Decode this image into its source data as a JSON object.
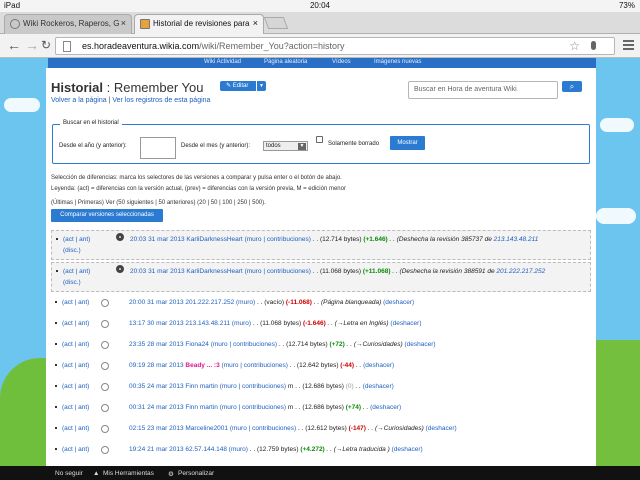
{
  "status": {
    "carrier": "iPad",
    "time": "20:04",
    "battery": "73%"
  },
  "tabs": [
    {
      "title": "Wiki Rockeros, Raperos, G",
      "close": "×"
    },
    {
      "title": "Historial de revisiones para",
      "close": "×"
    }
  ],
  "address": {
    "host": "es.horadeaventura.wikia.com",
    "path": "/wiki/Remember_You?action=history"
  },
  "nav": [
    "Wiki Actividad",
    "Página aleatoria",
    "Vídeos",
    "Imágenes nuevas"
  ],
  "page": {
    "title": "Historial",
    "subtitle": ": Remember You",
    "edit_label": "Editar",
    "back_link": "Volver a la página",
    "registry_link": "Ver los registros de esta página",
    "search_placeholder": "Buscar en Hora de aventura Wiki"
  },
  "filter": {
    "legend": "Buscar en el historial",
    "year_label": "Desde el año (y anterior):",
    "month_label": "Desde el mes (y anterior):",
    "month_value": "todos",
    "deleted_label": "Solamente borrado",
    "show_button": "Mostrar"
  },
  "help": {
    "line1": "Selección de diferencias: marca los selectores de las versiones a comparar y pulsa enter o el botón de abajo.",
    "line2": "Leyenda: (act) = diferencias con la versión actual, (prev) = diferencias con la versión previa, M = edición menor",
    "paging": "(Últimas | Primeras) Ver (50 siguientes | 50 anteriores) (20 | 50 | 100 | 250 | 500)."
  },
  "compare_button": "Comparar versiones seleccionadas",
  "revisions": [
    {
      "aa": "(act | ant)",
      "date": "20:03 31 mar 2013",
      "user": "KarliDarknessHeart",
      "tools": "(muro | contribuciones)",
      "size": ". . (12.714 bytes)",
      "diff": "(+1.646)",
      "diff_class": "pos",
      "summary": ". . (Deshecha la revisión 385737 de",
      "ip": "213.143.48.211",
      "extra": "(disc.)",
      "highlight": true,
      "radio": "on"
    },
    {
      "aa": "(act | ant)",
      "date": "20:03 31 mar 2013",
      "user": "KarliDarknessHeart",
      "tools": "(muro | contribuciones)",
      "size": ". . (11.068 bytes)",
      "diff": "(+11.068)",
      "diff_class": "pos",
      "summary": ". . (Deshecha la revisión 388591 de",
      "ip": "201.222.217.252",
      "extra": "(disc.)",
      "highlight": true,
      "radio": "on"
    },
    {
      "aa": "(act | ant)",
      "date": "20:00 31 mar 2013",
      "user": "201.222.217.252",
      "tools": "(muro)",
      "size": ". . (vacío)",
      "diff": "(-11.068)",
      "diff_class": "neg",
      "summary": ". . (Página blanqueada)",
      "ip": "",
      "extra": "(deshacer)",
      "highlight": false,
      "radio": "off"
    },
    {
      "aa": "(act | ant)",
      "date": "13:17 30 mar 2013",
      "user": "213.143.48.211",
      "tools": "(muro)",
      "size": ". . (11.068 bytes)",
      "diff": "(-1.646)",
      "diff_class": "neg",
      "summary": ". . (→Letra en Inglés)",
      "ip": "",
      "extra": "(deshacer)",
      "highlight": false,
      "radio": "off"
    },
    {
      "aa": "(act | ant)",
      "date": "23:35 28 mar 2013",
      "user": "Fiona24",
      "tools": "(muro | contribuciones)",
      "size": ". . (12.714 bytes)",
      "diff": "(+72)",
      "diff_class": "pos",
      "summary": ". . (→Curiosidades)",
      "ip": "",
      "extra": "(deshacer)",
      "highlight": false,
      "radio": "off"
    },
    {
      "aa": "(act | ant)",
      "date": "09:19 28 mar 2013",
      "user": "Beady ... :3",
      "tools": "(muro | contribuciones)",
      "size": ". . (12.642 bytes)",
      "diff": "(-44)",
      "diff_class": "neg",
      "summary": ". .",
      "ip": "",
      "extra": "(deshacer)",
      "highlight": false,
      "radio": "off",
      "magenta": true
    },
    {
      "aa": "(act | ant)",
      "date": "00:35 24 mar 2013",
      "user": "Finn martin",
      "tools": "(muro | contribuciones)",
      "size": "m . . (12.686 bytes)",
      "diff": "(0)",
      "diff_class": "neu",
      "summary": ". .",
      "ip": "",
      "extra": "(deshacer)",
      "highlight": false,
      "radio": "off"
    },
    {
      "aa": "(act | ant)",
      "date": "00:31 24 mar 2013",
      "user": "Finn martin",
      "tools": "(muro | contribuciones)",
      "size": "m . . (12.686 bytes)",
      "diff": "(+74)",
      "diff_class": "pos",
      "summary": ". .",
      "ip": "",
      "extra": "(deshacer)",
      "highlight": false,
      "radio": "off"
    },
    {
      "aa": "(act | ant)",
      "date": "02:15 23 mar 2013",
      "user": "Marceline2001",
      "tools": "(muro | contribuciones)",
      "size": ". . (12.612 bytes)",
      "diff": "(-147)",
      "diff_class": "neg",
      "summary": ". . (→Curiosidades)",
      "ip": "",
      "extra": "(deshacer)",
      "highlight": false,
      "radio": "off"
    },
    {
      "aa": "(act | ant)",
      "date": "19:24 21 mar 2013",
      "user": "62.57.144.148",
      "tools": "(muro)",
      "size": ". . (12.759 bytes)",
      "diff": "(+4.272)",
      "diff_class": "pos",
      "summary": ". . (→Letra traducida )",
      "ip": "",
      "extra": "(deshacer)",
      "highlight": false,
      "radio": "off"
    }
  ],
  "bottombar": {
    "unfollow": "No seguir",
    "tools": "Mis Herramientas",
    "customize": "Personalizar"
  }
}
